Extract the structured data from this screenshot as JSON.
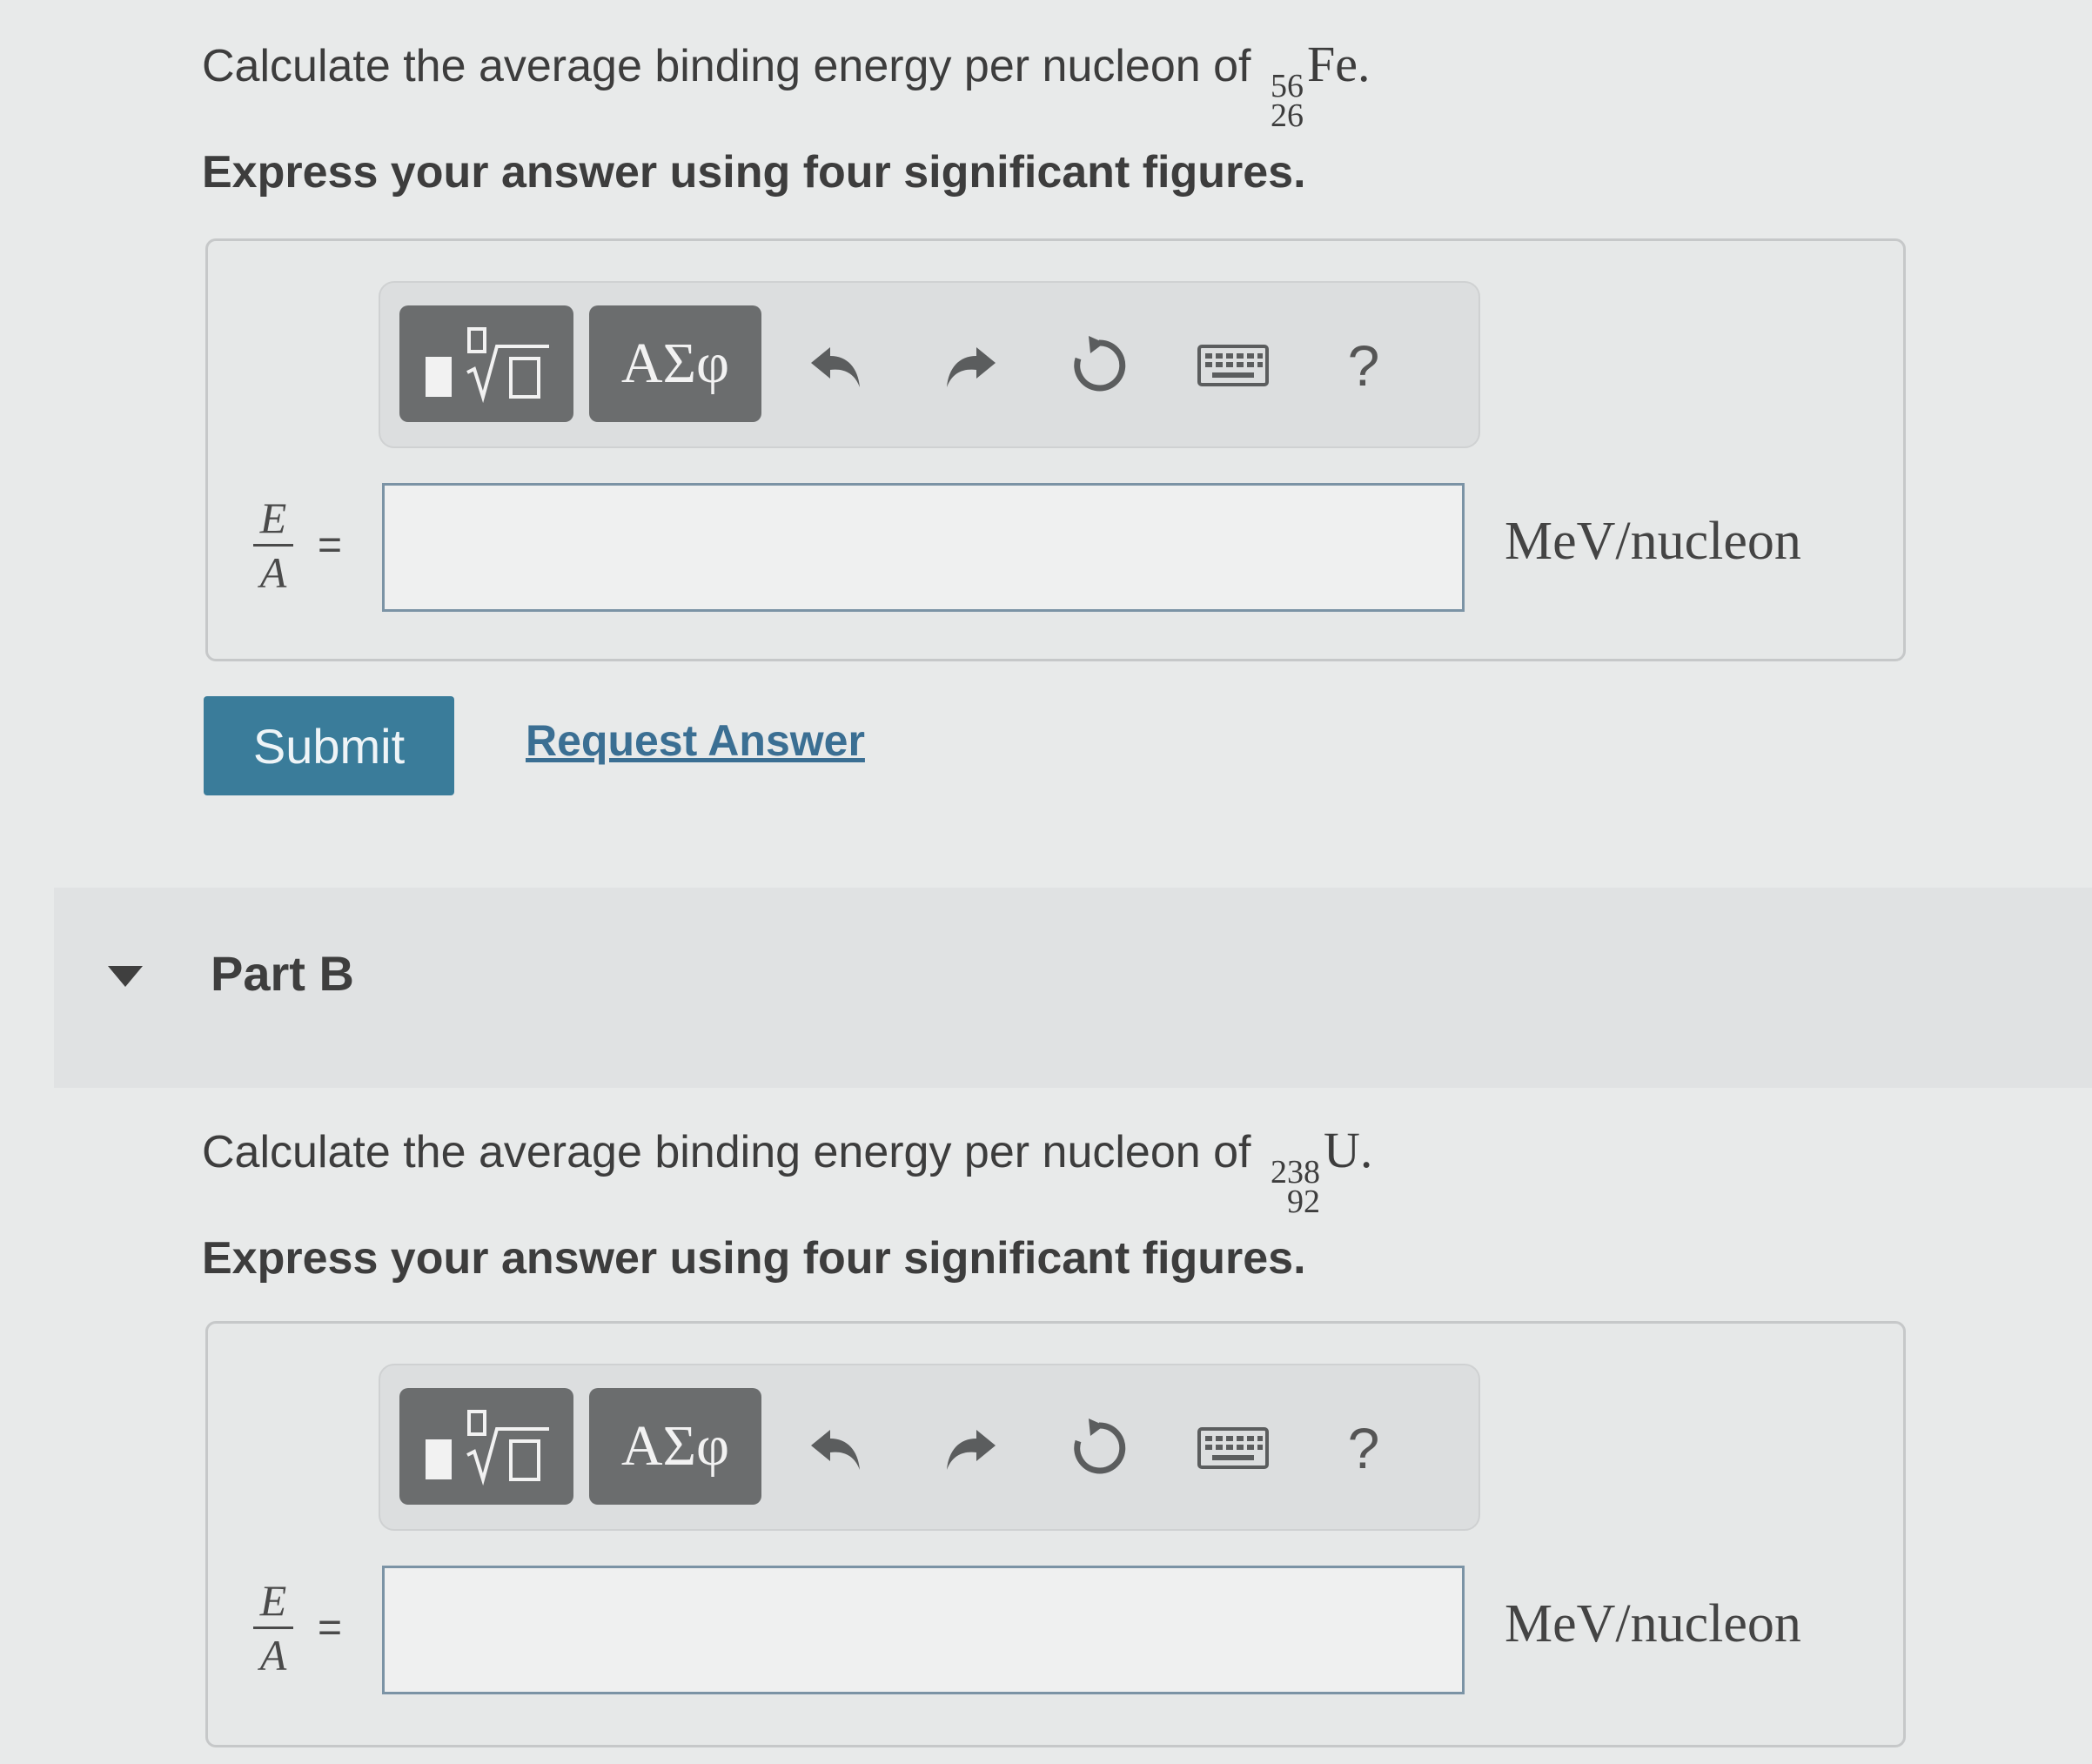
{
  "partA": {
    "question_prefix": "Calculate the average binding energy per nucleon of",
    "nuclide_mass": "56",
    "nuclide_atomic": "26",
    "nuclide_symbol": "Fe",
    "question_suffix": ".",
    "instruction": "Express your answer using four significant figures.",
    "toolbar": {
      "symbols_label": "ΑΣφ",
      "help_label": "?"
    },
    "eq_numerator": "E",
    "eq_denominator": "A",
    "eq_sign": "=",
    "answer_value": "",
    "unit": "MeV/nucleon",
    "submit_label": "Submit",
    "request_label": "Request Answer"
  },
  "partB": {
    "title": "Part B",
    "question_prefix": "Calculate the average binding energy per nucleon of",
    "nuclide_mass": "238",
    "nuclide_atomic": "92",
    "nuclide_symbol": "U",
    "question_suffix": ".",
    "instruction": "Express your answer using four significant figures.",
    "toolbar": {
      "symbols_label": "ΑΣφ",
      "help_label": "?"
    },
    "eq_numerator": "E",
    "eq_denominator": "A",
    "eq_sign": "=",
    "answer_value": "",
    "unit": "MeV/nucleon"
  },
  "colors": {
    "submit": "#3a7c9a",
    "link": "#3b6f93",
    "toolbar_button": "#6b6d6e",
    "input_border": "#7b93a5"
  }
}
